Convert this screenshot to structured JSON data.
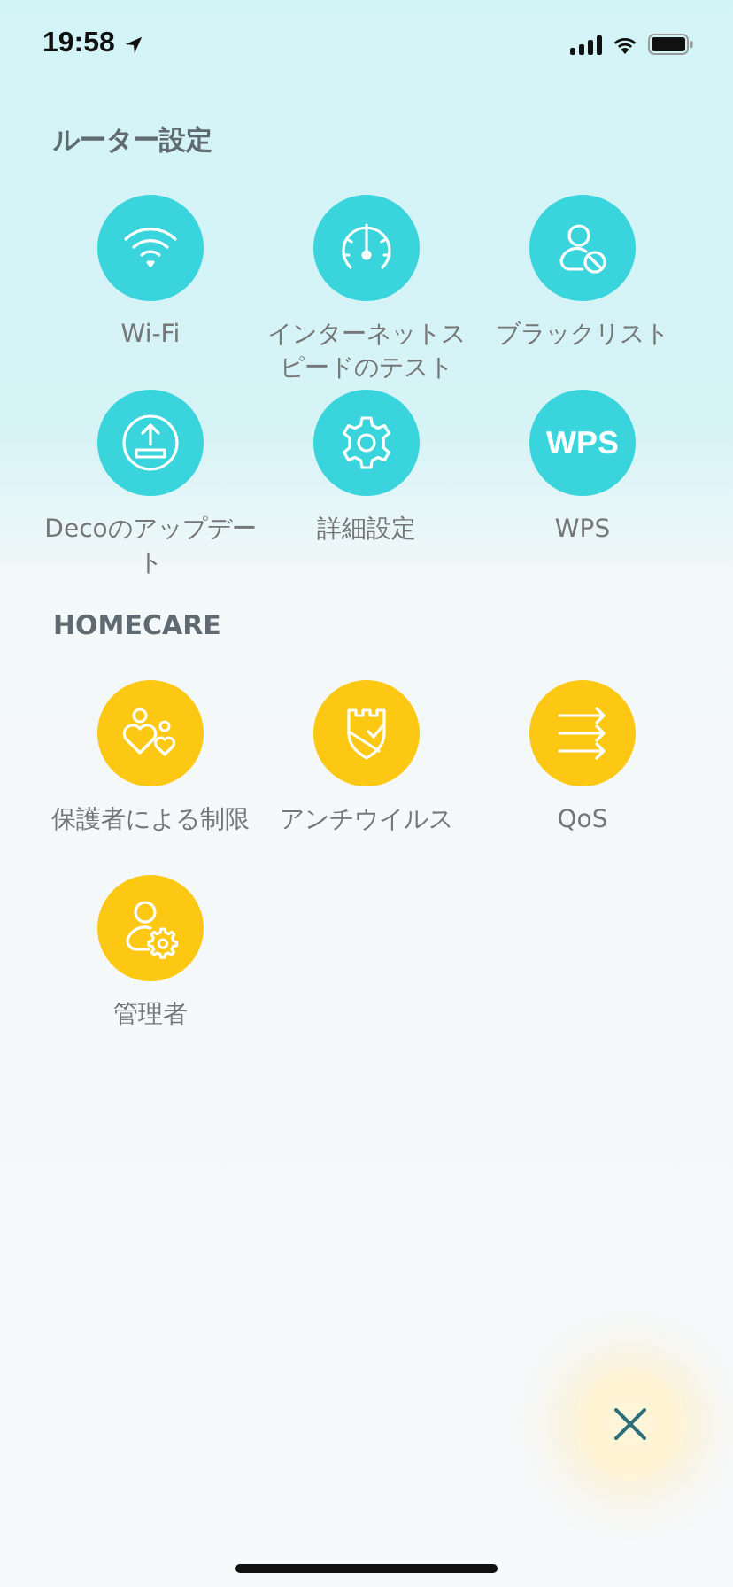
{
  "status_bar": {
    "time": "19:58"
  },
  "sections": [
    {
      "title": "ルーター設定",
      "color": "#3ad4dc",
      "items": [
        {
          "label": "Wi-Fi",
          "kind": "wifi"
        },
        {
          "label": "インターネットスピードのテスト",
          "kind": "speed"
        },
        {
          "label": "ブラックリスト",
          "kind": "block"
        },
        {
          "label": "Decoのアップデート",
          "kind": "upload"
        },
        {
          "label": "詳細設定",
          "kind": "gear"
        },
        {
          "label": "WPS",
          "kind": "text",
          "icon_text": "WPS"
        }
      ]
    },
    {
      "title": "HOMECARE",
      "color": "#fdc813",
      "items": [
        {
          "label": "保護者による制限",
          "kind": "family"
        },
        {
          "label": "アンチウイルス",
          "kind": "shield"
        },
        {
          "label": "QoS",
          "kind": "qos"
        },
        {
          "label": "管理者",
          "kind": "admin"
        }
      ]
    }
  ]
}
